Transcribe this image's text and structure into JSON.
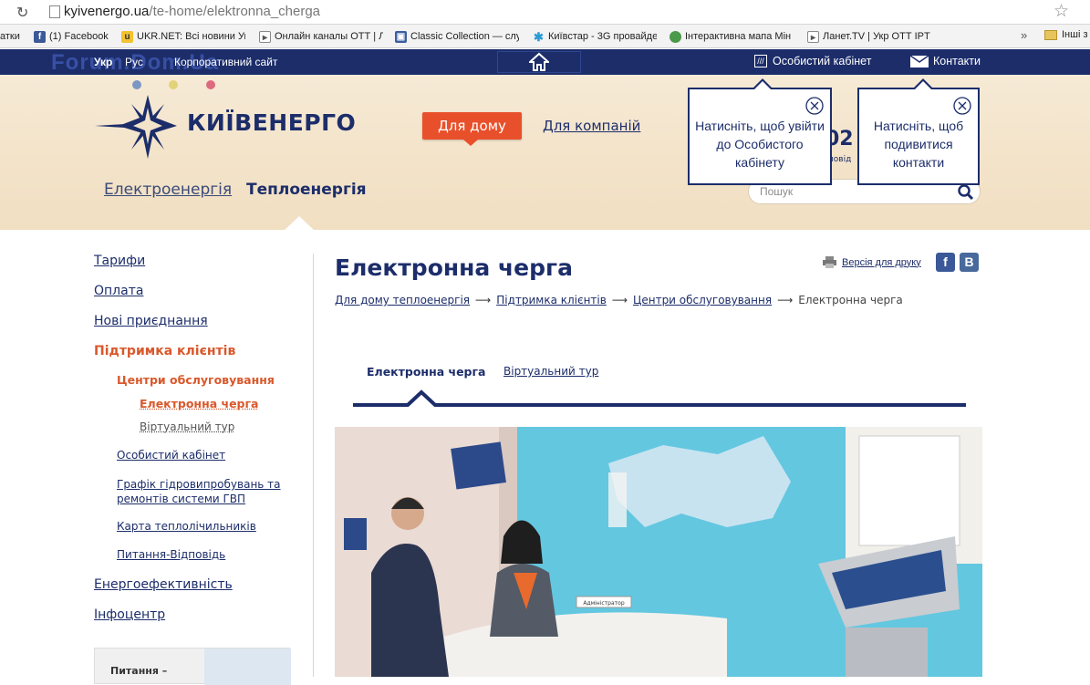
{
  "browser": {
    "url_host": "kyivenergo.ua",
    "url_path": "/te-home/elektronna_cherga",
    "bookmarks": [
      {
        "label": "атки",
        "icon": "none"
      },
      {
        "label": "(1) Facebook",
        "icon": "facebook-icon"
      },
      {
        "label": "UKR.NET: Всі новини Ук",
        "icon": "ukrnet-icon"
      },
      {
        "label": "Онлайн каналы ОТТ | Л",
        "icon": "play-icon"
      },
      {
        "label": "Classic Collection — слух",
        "icon": "image-icon"
      },
      {
        "label": "Київстар - 3G провайде",
        "icon": "kyivstar-icon"
      },
      {
        "label": "Інтерактивна мапа Мін",
        "icon": "map-icon"
      },
      {
        "label": "Ланет.TV | Укр ОТТ IPT",
        "icon": "play-icon"
      }
    ],
    "other_bookmarks": "Інші з"
  },
  "topbar": {
    "lang_ukr": "Укр",
    "lang_rus": "Рус",
    "corporate": "Корпоративний сайт",
    "watermark": "Forum.Dom.Ua",
    "cabinet": "Особистий кабінет",
    "contacts": "Контакти"
  },
  "header": {
    "logo_text": "КИЇВЕНЕРГО",
    "for_home": "Для дому",
    "for_companies": "Для компаній",
    "tab_electro": "Електроенергія",
    "tab_teplo": "Теплоенергія",
    "phone_fragment": "02",
    "phone_sub_fragment": "ловід",
    "search_placeholder": "Пошук",
    "tooltip_cabinet": "Натисніть, щоб увійти до Особистого кабінету",
    "tooltip_contacts": "Натисніть, щоб подивитися контакти",
    "colors": {
      "navy": "#1c2d6a",
      "orange": "#e8502b",
      "dot_blue": "#7d97c3",
      "dot_yellow": "#e2d27a",
      "dot_red": "#dd6b80"
    }
  },
  "sidebar": {
    "tariffs": "Тарифи",
    "payment": "Оплата",
    "new_connections": "Нові приєднання",
    "support": "Підтримка клієнтів",
    "service_centers": "Центри обслуговування",
    "queue": "Електронна черга",
    "virtual_tour": "Віртуальний тур",
    "cabinet": "Особистий кабінет",
    "schedule": "Графік гідровипробувань та ремонтів системи ГВП",
    "heat_meters": "Карта теплолічильників",
    "faq": "Питання-Відповідь",
    "efficiency": "Енергоефективність",
    "infocenter": "Інфоцентр",
    "box_label": "Питання –"
  },
  "main": {
    "title": "Електронна черга",
    "print": "Версія для друку",
    "breadcrumbs": [
      "Для дому теплоенергія",
      "Підтримка клієнтів",
      "Центри обслуговування",
      "Електронна черга"
    ],
    "breadcrumb_sep": "⟶",
    "subtab_active": "Електронна черга",
    "subtab_other": "Віртуальний тур",
    "photo_sign": "Адміністратор"
  }
}
